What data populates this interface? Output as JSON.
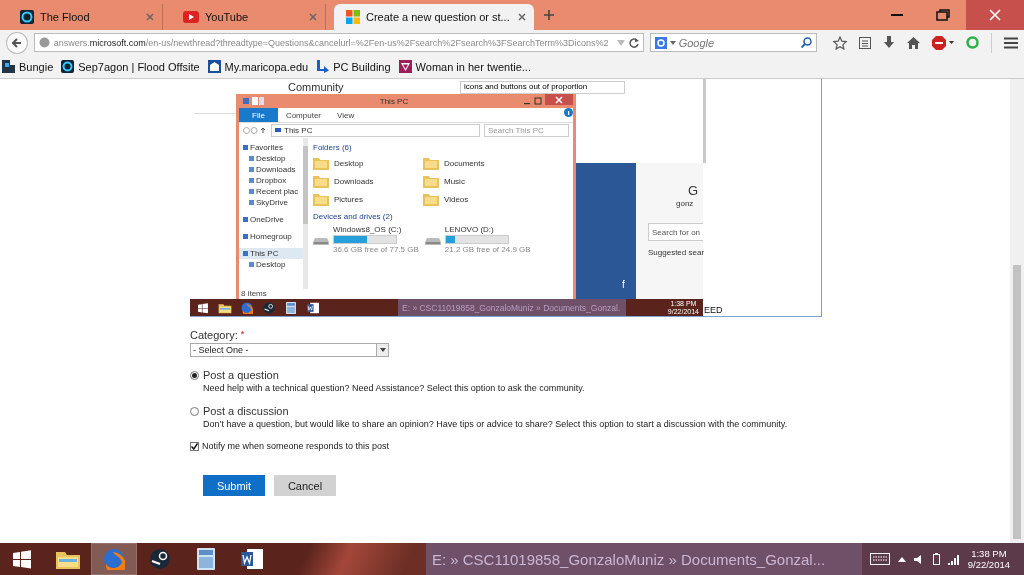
{
  "browser": {
    "tabs": [
      {
        "title": "The Flood",
        "selected": false
      },
      {
        "title": "YouTube",
        "selected": false
      },
      {
        "title": "Create a new question or st...",
        "selected": true
      }
    ],
    "url": {
      "subdomain": "answers.",
      "domain": "microsoft.com",
      "path": "/en-us/newthread?threadtype=Questions&cancelurl=%2Fen-us%2Fsearch%2Fsearch%3FSearchTerm%3Dicons%2"
    },
    "search": {
      "placeholder": "Google"
    },
    "bookmarks": [
      "Bungie",
      "Sep7agon | Flood Offsite",
      "My.maricopa.edu",
      "PC Building",
      "Woman in her twentie..."
    ]
  },
  "attached_screenshot": {
    "heading": "Community",
    "search_value": "icons and buttons out of proportion",
    "explorer": {
      "title": "This PC",
      "ribbon_tabs": [
        {
          "label": "File",
          "selected": true
        },
        {
          "label": "Computer",
          "selected": false
        },
        {
          "label": "View",
          "selected": false
        }
      ],
      "address": "This PC",
      "search_placeholder": "Search This PC",
      "nav": [
        {
          "label": "Favorites",
          "selected": false,
          "children": [
            {
              "label": "Desktop",
              "selected": false
            },
            {
              "label": "Downloads",
              "selected": false
            },
            {
              "label": "Dropbox",
              "selected": false
            },
            {
              "label": "Recent plac",
              "selected": false
            },
            {
              "label": "SkyDrive",
              "selected": false
            }
          ]
        },
        {
          "label": "OneDrive",
          "selected": false
        },
        {
          "label": "Homegroup",
          "selected": false
        },
        {
          "label": "This PC",
          "selected": true,
          "children": [
            {
              "label": "Desktop",
              "selected": false
            }
          ]
        }
      ],
      "folders_heading": "Folders (6)",
      "folders": [
        "Desktop",
        "Documents",
        "Downloads",
        "Music",
        "Pictures",
        "Videos"
      ],
      "drives_heading": "Devices and drives (2)",
      "drives": [
        {
          "name": "Windows8_OS (C:)",
          "level": 0.53,
          "free": "36.6 GB free of 77.5 GB"
        },
        {
          "name": "LENOVO (D:)",
          "level": 0.15,
          "free": "21.2 GB free of 24.9 GB"
        }
      ],
      "status": "8 items"
    },
    "side_letter": "f",
    "account_initial": "G",
    "account_name": "gonz",
    "search_placeholder": "Search for on",
    "suggested": "Suggested sear",
    "taskbar_title": "E: » CSC11019858_GonzaloMuniz » Documents_Gonzal.",
    "clock_time": "1:38 PM",
    "clock_date": "9/22/2014",
    "trailing_text": "EED"
  },
  "form": {
    "category": {
      "label": "Category:",
      "required_mark": "*",
      "value": "- Select One -"
    },
    "post_types": [
      {
        "title": "Post a question",
        "description": "Need help with a technical question? Need Assistance? Select this option to ask the community.",
        "selected": true
      },
      {
        "title": "Post a discussion",
        "description": "Don’t have a question, but would like to share an opinion? Have tips or advice to share? Select this option to start a discussion with the community.",
        "selected": false
      }
    ],
    "notify": {
      "label": "Notify me when someone responds to this post",
      "checked": true
    },
    "buttons": [
      {
        "label": "Submit",
        "kind": "primary"
      },
      {
        "label": "Cancel",
        "kind": "secondary"
      }
    ]
  },
  "taskbar": {
    "apps": [
      {
        "selected": false
      },
      {
        "selected": false
      },
      {
        "selected": true
      },
      {
        "selected": false
      },
      {
        "selected": false
      },
      {
        "selected": false
      }
    ],
    "window_title": "E: » CSC11019858_GonzaloMuniz » Documents_Gonzal...",
    "time": "1:38 PM",
    "date": "9/22/2014"
  }
}
